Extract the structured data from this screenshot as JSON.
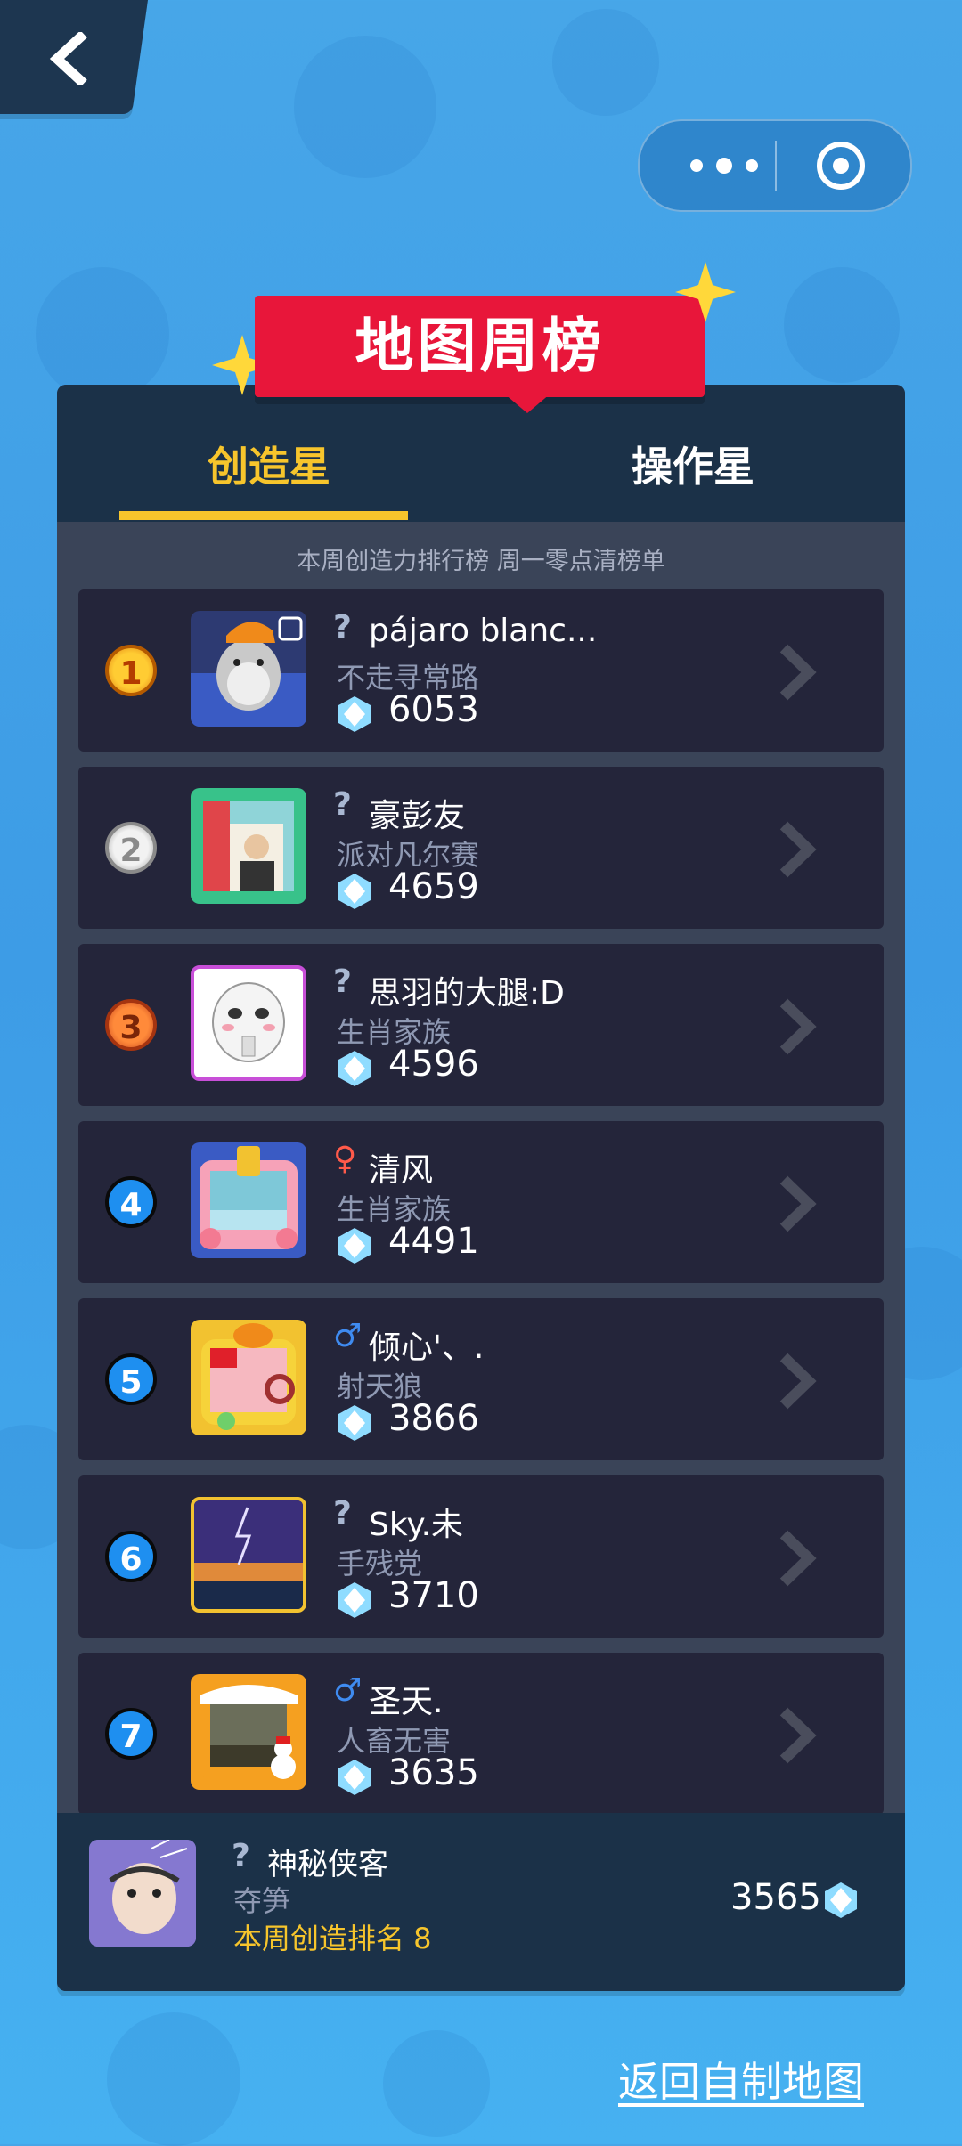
{
  "header": {
    "back_icon": "chevron-left-icon",
    "menu_icon": "more-dots-icon",
    "close_icon": "target-circle-icon"
  },
  "banner": {
    "title": "地图周榜"
  },
  "tabs": [
    {
      "label": "创造星",
      "active": true
    },
    {
      "label": "操作星",
      "active": false
    }
  ],
  "subtitle": "本周创造力排行榜 周一零点清榜单",
  "ranking": [
    {
      "rank": "1",
      "gender": "?",
      "name": "pájaro blanc...",
      "group": "不走寻常路",
      "score": "6053"
    },
    {
      "rank": "2",
      "gender": "?",
      "name": "豪彭友",
      "group": "派对凡尔赛",
      "score": "4659"
    },
    {
      "rank": "3",
      "gender": "?",
      "name": "思羽的大腿:D",
      "group": "生肖家族",
      "score": "4596"
    },
    {
      "rank": "4",
      "gender": "♀",
      "name": "清风",
      "group": "生肖家族",
      "score": "4491"
    },
    {
      "rank": "5",
      "gender": "♂",
      "name": "倾心'、.",
      "group": "射天狼",
      "score": "3866"
    },
    {
      "rank": "6",
      "gender": "?",
      "name": "Sky.未",
      "group": "手残党",
      "score": "3710"
    },
    {
      "rank": "7",
      "gender": "♂",
      "name": "圣天.",
      "group": "人畜无害",
      "score": "3635"
    }
  ],
  "me": {
    "gender": "?",
    "name": "神秘侠客",
    "group": "夺笋",
    "rank_text": "本周创造排名 8",
    "score": "3565"
  },
  "footer_link": "返回自制地图",
  "colors": {
    "gold": "#f7c52c",
    "banner_red": "#e8163a",
    "panel_dark": "#1b3148",
    "row_bg": "#24253a"
  }
}
